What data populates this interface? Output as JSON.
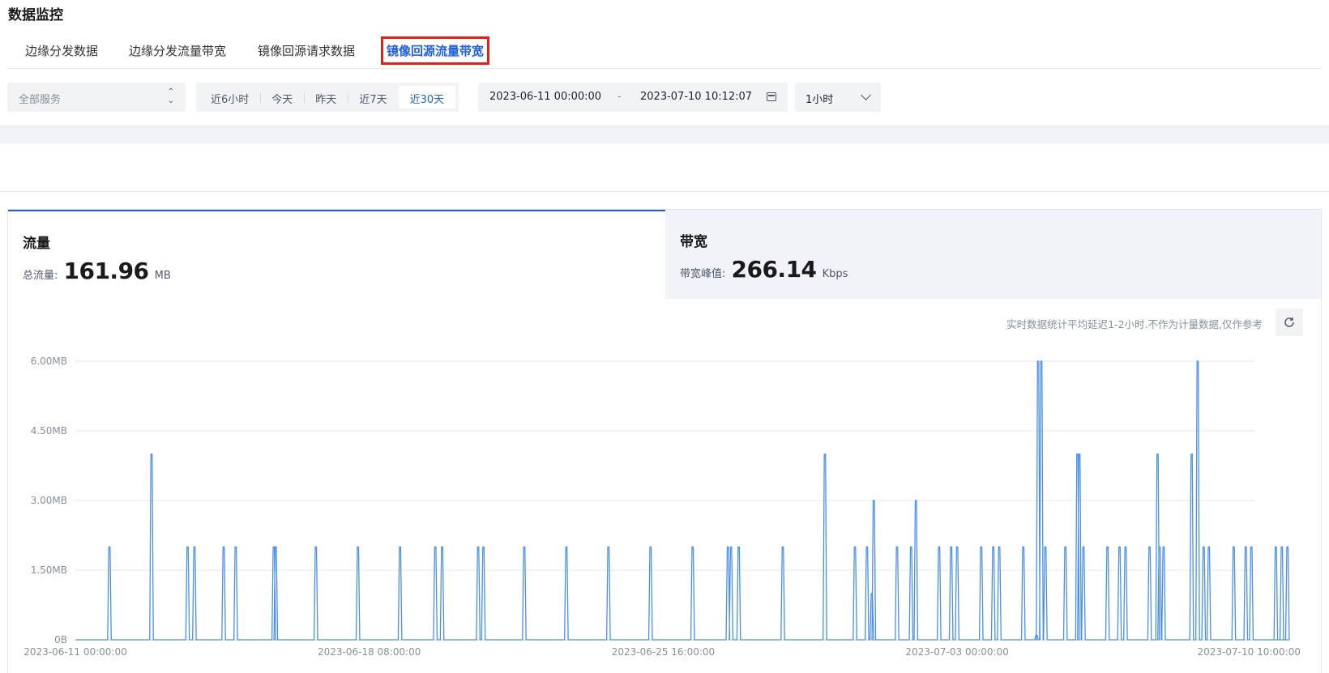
{
  "header": {
    "title": "数据监控"
  },
  "tabs": [
    {
      "label": "边缘分发数据"
    },
    {
      "label": "边缘分发流量带宽"
    },
    {
      "label": "镜像回源请求数据"
    },
    {
      "label": "镜像回源流量带宽",
      "active": true
    }
  ],
  "filters": {
    "service_placeholder": "全部服务",
    "ranges": [
      {
        "label": "近6小时"
      },
      {
        "label": "今天"
      },
      {
        "label": "昨天"
      },
      {
        "label": "近7天"
      },
      {
        "label": "近30天",
        "active": true
      }
    ],
    "date_start": "2023-06-11 00:00:00",
    "date_separator": "-",
    "date_end": "2023-07-10 10:12:07",
    "interval": "1小时"
  },
  "stats": {
    "traffic": {
      "title": "流量",
      "label": "总流量:",
      "value": "161.96",
      "unit": "MB"
    },
    "bandwidth": {
      "title": "带宽",
      "label": "带宽峰值:",
      "value": "266.14",
      "unit": "Kbps"
    }
  },
  "note": "实时数据统计平均延迟1-2小时.不作为计量数据,仅作参考",
  "colors": {
    "accent": "#1e5fe6",
    "line": "#4a90e8",
    "highlight_border": "#e0201b"
  },
  "chart_data": {
    "type": "line",
    "title": "",
    "xlabel": "",
    "ylabel": "",
    "unit": "MB",
    "y_ticks": [
      "0B",
      "1.50MB",
      "3.00MB",
      "4.50MB",
      "6.00MB"
    ],
    "ylim": [
      0,
      6
    ],
    "x_ticks": [
      "2023-06-11 00:00:00",
      "2023-06-18 08:00:00",
      "2023-06-25 16:00:00",
      "2023-07-03 00:00:00",
      "2023-07-10 10:00:00"
    ],
    "grid": true,
    "series": [
      {
        "peaks_day_mb": [
          [
            0.85,
            2.0
          ],
          [
            1.9,
            4.0
          ],
          [
            2.8,
            2.0
          ],
          [
            2.97,
            2.0
          ],
          [
            3.7,
            2.0
          ],
          [
            4.0,
            2.0
          ],
          [
            4.95,
            2.0
          ],
          [
            5.0,
            2.0
          ],
          [
            6.0,
            2.0
          ],
          [
            7.05,
            2.0
          ],
          [
            8.1,
            2.0
          ],
          [
            8.98,
            2.0
          ],
          [
            9.15,
            2.0
          ],
          [
            10.05,
            2.0
          ],
          [
            10.18,
            2.0
          ],
          [
            11.2,
            2.0
          ],
          [
            12.25,
            2.0
          ],
          [
            13.3,
            2.0
          ],
          [
            14.35,
            2.0
          ],
          [
            15.4,
            2.0
          ],
          [
            16.28,
            2.0
          ],
          [
            16.36,
            2.0
          ],
          [
            16.55,
            2.0
          ],
          [
            17.65,
            2.0
          ],
          [
            18.7,
            4.0
          ],
          [
            19.45,
            2.0
          ],
          [
            19.75,
            2.0
          ],
          [
            19.87,
            1.0
          ],
          [
            19.92,
            3.0
          ],
          [
            20.5,
            2.0
          ],
          [
            20.85,
            2.0
          ],
          [
            20.97,
            3.0
          ],
          [
            21.55,
            2.0
          ],
          [
            21.85,
            2.0
          ],
          [
            22.0,
            2.0
          ],
          [
            22.6,
            2.0
          ],
          [
            22.9,
            2.0
          ],
          [
            23.05,
            2.0
          ],
          [
            23.65,
            2.0
          ],
          [
            23.98,
            0.1
          ],
          [
            24.02,
            6.0
          ],
          [
            24.1,
            6.0
          ],
          [
            24.2,
            2.0
          ],
          [
            24.7,
            2.0
          ],
          [
            25.0,
            4.0
          ],
          [
            25.05,
            4.0
          ],
          [
            25.15,
            2.0
          ],
          [
            25.75,
            2.0
          ],
          [
            26.05,
            2.0
          ],
          [
            26.2,
            2.0
          ],
          [
            26.8,
            2.0
          ],
          [
            27.0,
            4.0
          ],
          [
            27.05,
            2.0
          ],
          [
            27.15,
            2.0
          ],
          [
            27.85,
            4.0
          ],
          [
            28.0,
            6.0
          ],
          [
            28.15,
            2.0
          ],
          [
            28.28,
            2.0
          ],
          [
            28.9,
            2.0
          ],
          [
            29.2,
            2.0
          ],
          [
            29.34,
            2.0
          ],
          [
            29.95,
            2.0
          ],
          [
            30.1,
            2.0
          ],
          [
            30.24,
            2.0
          ]
        ]
      }
    ]
  }
}
